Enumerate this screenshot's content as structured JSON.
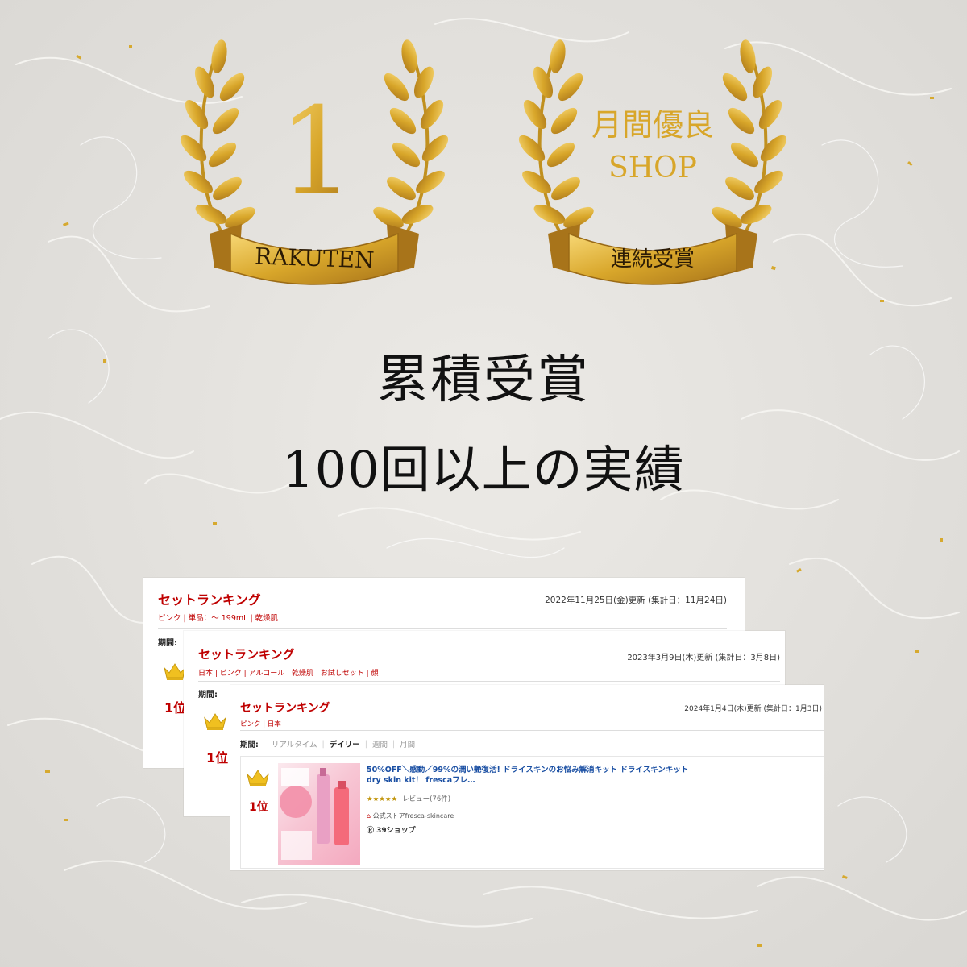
{
  "laurel_left": {
    "number": "1",
    "ribbon": "RAKUTEN"
  },
  "laurel_right": {
    "line1": "月間優良",
    "line2": "SHOP",
    "ribbon": "連続受賞"
  },
  "headline": {
    "line1": "累積受賞",
    "line2": "100回以上の実績"
  },
  "cards": [
    {
      "title": "セットランキング",
      "tags": "ピンク | 単品：～ 199mL | 乾燥肌",
      "date": "2022年11月25日(金)更新 (集計日：11月24日)",
      "period": "期間:",
      "rank": "1位"
    },
    {
      "title": "セットランキング",
      "tags": "日本 | ピンク | アルコール | 乾燥肌 | お試しセット | 顔",
      "date": "2023年3月9日(木)更新 (集計日：3月8日)",
      "period": "期間:",
      "rank": "1位"
    },
    {
      "title": "セットランキング",
      "tags": "ピンク | 日本",
      "date": "2024年1月4日(木)更新 (集計日：1月3日)",
      "period": "期間:",
      "tabs": [
        "リアルタイム",
        "デイリー",
        "週間",
        "月間"
      ],
      "rank": "1位",
      "product": {
        "name": "50%OFF＼感動／99%の潤い艶復活! ドライスキンのお悩み解消キット ドライスキンキット dry skin kit！ frescaフレ…",
        "stars": "★★★★★",
        "review": "レビュー(76件)",
        "shop": "公式ストアfresca-skincare",
        "points": "39ショップ"
      }
    }
  ],
  "colors": {
    "gold": "#d8a62a",
    "red": "#bf0000",
    "link": "#1a4fa3"
  }
}
